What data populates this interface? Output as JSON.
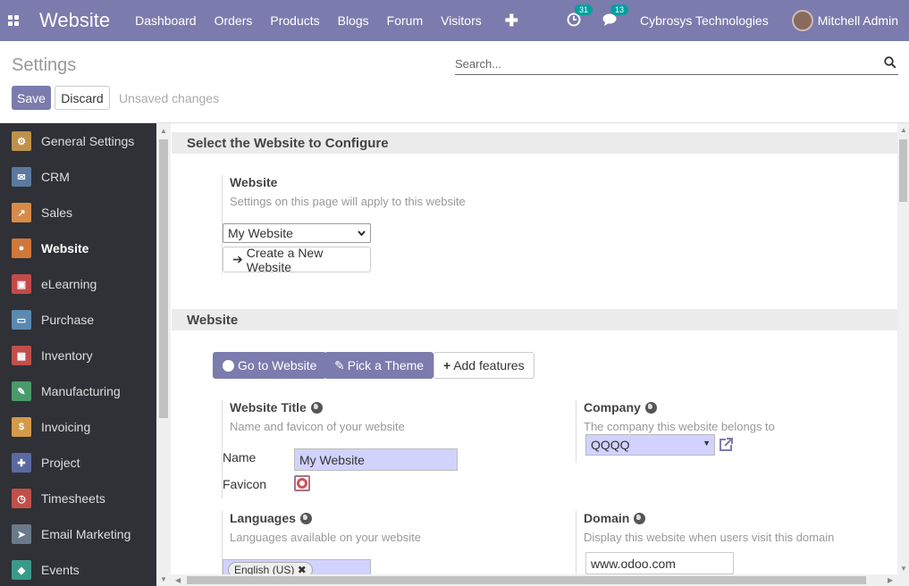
{
  "topbar": {
    "brand": "Website",
    "menu": [
      "Dashboard",
      "Orders",
      "Products",
      "Blogs",
      "Forum",
      "Visitors"
    ],
    "plus": "✚",
    "activity_count": "31",
    "messages_count": "13",
    "company": "Cybrosys Technologies",
    "user": "Mitchell Admin",
    "color": "#7c7bad"
  },
  "control_panel": {
    "title": "Settings",
    "search_placeholder": "Search...",
    "save_label": "Save",
    "discard_label": "Discard",
    "unsaved": "Unsaved changes"
  },
  "sidebar": {
    "items": [
      {
        "label": "General Settings",
        "icon": "gear-icon",
        "color": "#c0914a",
        "glyph": "⚙"
      },
      {
        "label": "CRM",
        "icon": "handshake-icon",
        "color": "#5a7a9e",
        "glyph": "✉"
      },
      {
        "label": "Sales",
        "icon": "chart-icon",
        "color": "#d88a4a",
        "glyph": "↗"
      },
      {
        "label": "Website",
        "icon": "globe-icon",
        "color": "#d0783a",
        "glyph": "●"
      },
      {
        "label": "eLearning",
        "icon": "elearning-icon",
        "color": "#c44a4a",
        "glyph": "▣"
      },
      {
        "label": "Purchase",
        "icon": "card-icon",
        "color": "#5a8ab0",
        "glyph": "▭"
      },
      {
        "label": "Inventory",
        "icon": "box-icon",
        "color": "#c0504a",
        "glyph": "▦"
      },
      {
        "label": "Manufacturing",
        "icon": "wrench-icon",
        "color": "#4a9a6a",
        "glyph": "✎"
      },
      {
        "label": "Invoicing",
        "icon": "invoice-icon",
        "color": "#d49a4a",
        "glyph": "$"
      },
      {
        "label": "Project",
        "icon": "puzzle-icon",
        "color": "#5a6aa0",
        "glyph": "✚"
      },
      {
        "label": "Timesheets",
        "icon": "stopwatch-icon",
        "color": "#c0504a",
        "glyph": "◷"
      },
      {
        "label": "Email Marketing",
        "icon": "paper-plane-icon",
        "color": "#6a7a8a",
        "glyph": "➤"
      },
      {
        "label": "Events",
        "icon": "ticket-icon",
        "color": "#3a9a8a",
        "glyph": "◆"
      }
    ],
    "active_index": 3
  },
  "main": {
    "section1": {
      "title": "Select the Website to Configure",
      "label": "Website",
      "desc": "Settings on this page will apply to this website",
      "select_value": "My Website",
      "create_button": "Create a New Website"
    },
    "section2": {
      "title": "Website",
      "go_button": "Go to Website",
      "theme_button": "Pick a Theme",
      "features_button": "Add features",
      "title_setting": {
        "label": "Website Title",
        "desc": "Name and favicon of your website",
        "name_label": "Name",
        "name_value": "My Website",
        "favicon_label": "Favicon"
      },
      "company_setting": {
        "label": "Company",
        "desc": "The company this website belongs to",
        "value": "QQQQ"
      },
      "languages_setting": {
        "label": "Languages",
        "desc": "Languages available on your website",
        "tag": "English (US)"
      },
      "domain_setting": {
        "label": "Domain",
        "desc": "Display this website when users visit this domain",
        "value": "www.odoo.com"
      }
    }
  }
}
